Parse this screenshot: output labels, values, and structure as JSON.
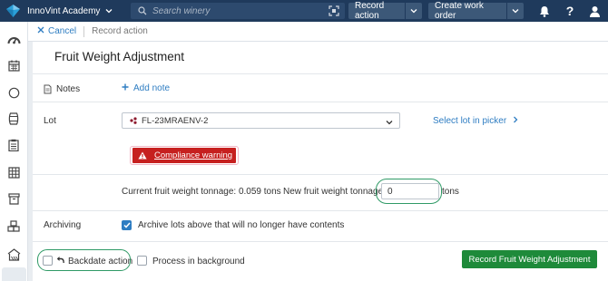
{
  "topbar": {
    "org_name": "InnoVint Academy",
    "search_placeholder": "Search winery",
    "record_action_label": "Record action",
    "create_work_order_label": "Create work order"
  },
  "breadcrumb": {
    "cancel_label": "Cancel",
    "current": "Record action"
  },
  "form": {
    "title": "Fruit Weight Adjustment",
    "notes_label": "Notes",
    "add_note_label": "Add note",
    "lot_label": "Lot",
    "lot_value": "FL-23MRAENV-2",
    "select_lot_label": "Select lot in picker",
    "compliance_warning": "Compliance warning",
    "current_tonnage_text": "Current fruit weight tonnage: 0.059 tons",
    "new_tonnage_label": "New fruit weight tonnage",
    "new_tonnage_value": "0",
    "tons_unit": "tons",
    "archiving_label": "Archiving",
    "archive_text": "Archive lots above that will no longer have contents",
    "archive_checked": true,
    "backdate_label": "Backdate action",
    "backdate_checked": false,
    "process_bg_label": "Process in background",
    "process_bg_checked": false,
    "submit_label": "Record Fruit Weight Adjustment"
  },
  "colors": {
    "topbar": "#1f3a5c",
    "accent_blue": "#2e7dc2",
    "warning_red": "#c6201f",
    "submit_green": "#1e8a3a",
    "highlight_green": "#2f9a66"
  }
}
